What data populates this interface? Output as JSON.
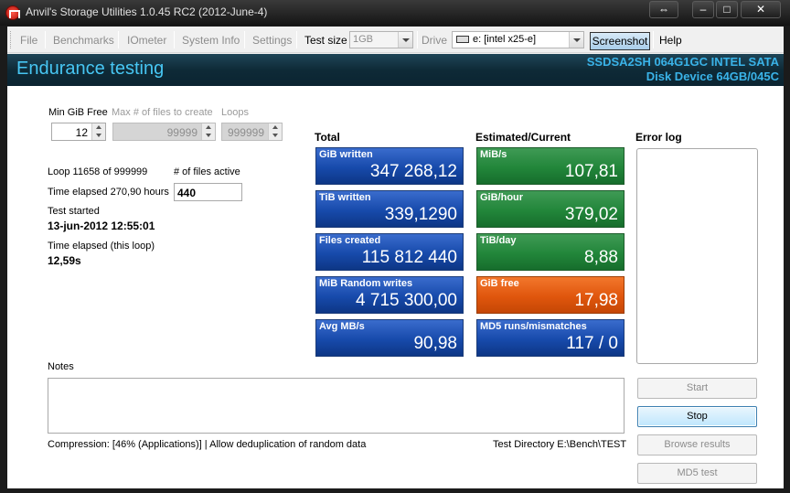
{
  "window": {
    "title": "Anvil's Storage Utilities 1.0.45 RC2 (2012-June-4)"
  },
  "toolbar": {
    "file": "File",
    "benchmarks": "Benchmarks",
    "iometer": "IOmeter",
    "system_info": "System Info",
    "settings": "Settings",
    "test_size_label": "Test size",
    "test_size_value": "1GB",
    "drive_label": "Drive",
    "drive_value": "e: [intel x25-e]",
    "screenshot": "Screenshot",
    "help": "Help"
  },
  "header": {
    "title": "Endurance testing",
    "device_line1": "SSDSA2SH 064G1GC INTEL SATA",
    "device_line2": "Disk Device 64GB/045C"
  },
  "settings": {
    "min_gib_free_label": "Min GiB Free",
    "min_gib_free_value": "12",
    "max_files_label": "Max # of files to create",
    "max_files_value": "99999",
    "loops_label": "Loops",
    "loops_value": "999999"
  },
  "status": {
    "loop_text": "Loop 11658 of 999999",
    "files_active_label": "# of files active",
    "files_active_value": "440",
    "time_elapsed_text": "Time elapsed 270,90 hours",
    "test_started_label": "Test started",
    "test_started_value": "13-jun-2012 12:55:01",
    "time_elapsed_loop_label": "Time elapsed (this loop)",
    "time_elapsed_loop_value": "12,59s"
  },
  "total": {
    "heading": "Total",
    "tiles": [
      {
        "label": "GiB written",
        "value": "347 268,12"
      },
      {
        "label": "TiB written",
        "value": "339,1290"
      },
      {
        "label": "Files created",
        "value": "115 812 440"
      },
      {
        "label": "MiB Random writes",
        "value": "4 715 300,00"
      },
      {
        "label": "Avg MB/s",
        "value": "90,98"
      }
    ]
  },
  "current": {
    "heading": "Estimated/Current",
    "tiles": [
      {
        "label": "MiB/s",
        "value": "107,81",
        "color": "#22863a"
      },
      {
        "label": "GiB/hour",
        "value": "379,02",
        "color": "#22863a"
      },
      {
        "label": "TiB/day",
        "value": "8,88",
        "color": "#22863a"
      },
      {
        "label": "GiB free",
        "value": "17,98",
        "color": "#e0560d"
      },
      {
        "label": "MD5 runs/mismatches",
        "value": "117 / 0",
        "color": "#174aab"
      }
    ]
  },
  "error_log": {
    "heading": "Error log"
  },
  "notes": {
    "label": "Notes"
  },
  "footer": {
    "compression": "Compression: [46% (Applications)] | Allow deduplication of random data",
    "test_directory": "Test Directory E:\\Bench\\TEST"
  },
  "buttons": {
    "start": "Start",
    "stop": "Stop",
    "browse": "Browse results",
    "md5": "MD5 test"
  },
  "colors": {
    "header_bg": "#0e2a37",
    "header_text": "#47c6f3",
    "tile_blue": "#174aab",
    "tile_green": "#22863a",
    "tile_orange": "#e0560d"
  }
}
